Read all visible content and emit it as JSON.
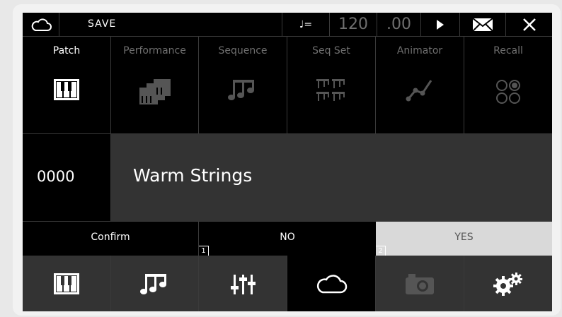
{
  "header": {
    "save_label": "SAVE",
    "tempo_prefix": "♩=",
    "tempo_value": "120",
    "tempo_fraction": ".00",
    "icons": [
      "cloud-icon",
      "play-icon",
      "mail-icon",
      "close-icon"
    ]
  },
  "tabs": [
    {
      "label": "Patch",
      "active": true,
      "icon": "piano-keys-icon"
    },
    {
      "label": "Performance",
      "active": false,
      "icon": "stacked-piano-icon"
    },
    {
      "label": "Sequence",
      "active": false,
      "icon": "music-notes-icon"
    },
    {
      "label": "Seq Set",
      "active": false,
      "icon": "note-grid-icon"
    },
    {
      "label": "Animator",
      "active": false,
      "icon": "graph-curve-icon"
    },
    {
      "label": "Recall",
      "active": false,
      "icon": "circles-icon"
    }
  ],
  "patch": {
    "number": "0000",
    "name": "Warm Strings"
  },
  "confirm": {
    "label": "Confirm",
    "no_label": "NO",
    "no_index": "1",
    "yes_label": "YES",
    "yes_index": "2"
  },
  "bottom_bar": {
    "icons": [
      "piano-keys-icon",
      "music-notes-icon",
      "mixer-sliders-icon",
      "cloud-icon",
      "camera-icon",
      "gears-icon"
    ]
  },
  "colors": {
    "background": "#000000",
    "patch_name_bg": "#333333",
    "yes_bg": "#d9d9d9",
    "dim_text": "#6f6f6f",
    "grid_line": "#3a3a3a"
  }
}
